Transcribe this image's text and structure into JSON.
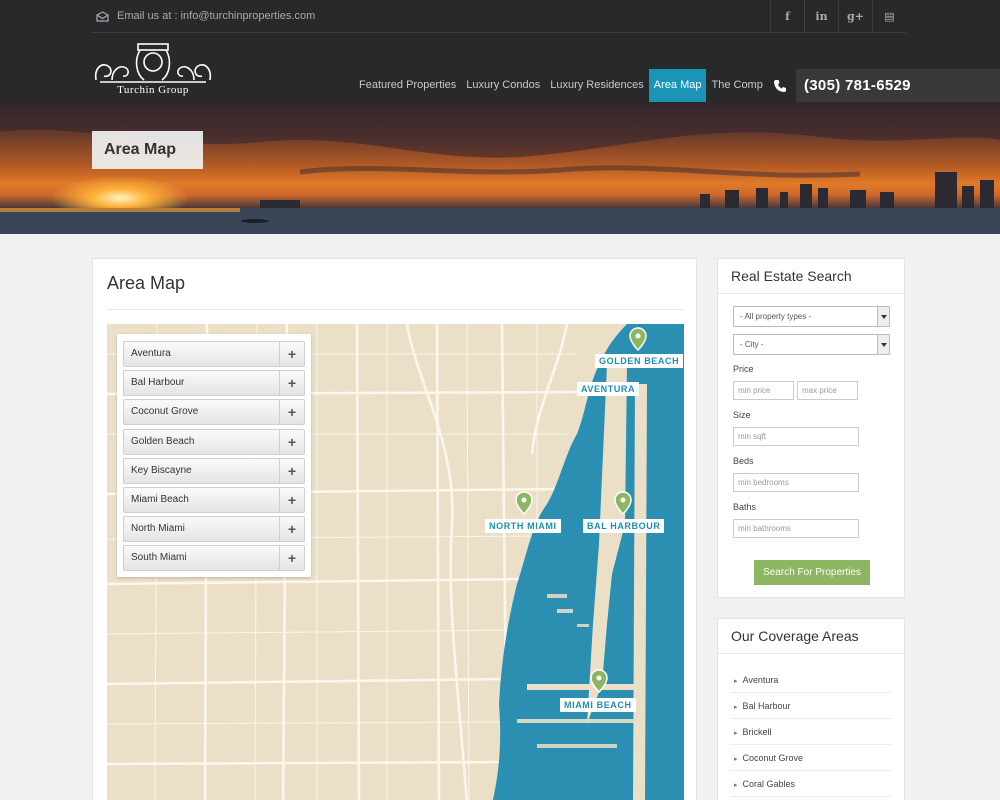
{
  "topbar": {
    "email_text": "Email us at : info@turchinproperties.com",
    "social_icons": [
      "facebook-icon",
      "linkedin-icon",
      "google-plus-icon",
      "calendar-icon"
    ],
    "social_glyphs": [
      "f",
      "in",
      "g+",
      "▤"
    ]
  },
  "logo": {
    "text": "Turchin Group"
  },
  "nav": {
    "items": [
      "Featured Properties",
      "Luxury Condos",
      "Luxury Residences",
      "Area Map",
      "The Company"
    ],
    "active": "Area Map"
  },
  "phone": {
    "number": "(305) 781-6529"
  },
  "banner": {
    "title": "Area Map"
  },
  "main": {
    "title": "Area Map",
    "areas": [
      "Aventura",
      "Bal Harbour",
      "Coconut Grove",
      "Golden Beach",
      "Key Biscayne",
      "Miami Beach",
      "North Miami",
      "South Miami"
    ],
    "plus": "+",
    "markers": [
      "GOLDEN BEACH",
      "AVENTURA",
      "NORTH MIAMI",
      "BAL HARBOUR",
      "MIAMI BEACH"
    ]
  },
  "search": {
    "title": "Real Estate Search",
    "property_type": "- All property types -",
    "city": "- City -",
    "price_label": "Price",
    "min_price": "min price",
    "max_price": "max price",
    "size_label": "Size",
    "min_sqft": "min sqft",
    "beds_label": "Beds",
    "min_bedrooms": "min bedrooms",
    "baths_label": "Baths",
    "min_bathrooms": "min bathrooms",
    "button": "Search For Properties"
  },
  "coverage": {
    "title": "Our Coverage Areas",
    "bullet": "▸",
    "items": [
      "Aventura",
      "Bal Harbour",
      "Brickell",
      "Coconut Grove",
      "Coral Gables"
    ]
  },
  "colors": {
    "accent": "#1a95b8",
    "button": "#8cb661",
    "header": "#27292b",
    "water": "#2b8fb1",
    "land": "#ebe0c7"
  }
}
